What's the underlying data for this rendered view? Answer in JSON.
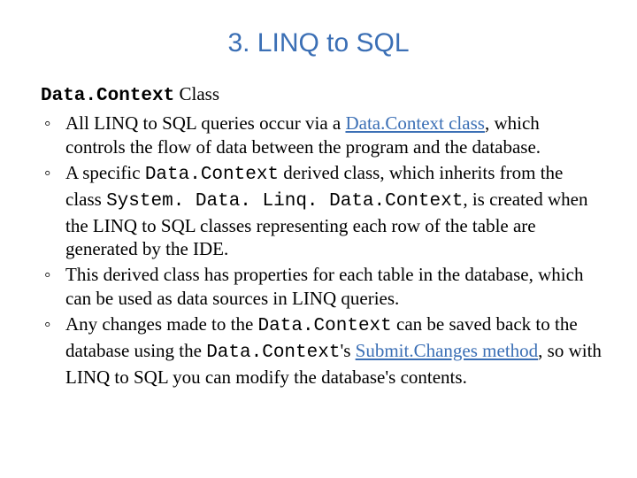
{
  "title": "3. LINQ to SQL",
  "subheading": {
    "code": "Data.Context",
    "rest": " Class"
  },
  "bullets": {
    "b1": {
      "pre": "All LINQ to SQL queries occur via a ",
      "link": "Data.Context class",
      "post": ", which controls the flow of data between the program and the database."
    },
    "b2": {
      "t1": "A specific ",
      "c1": "Data.Context",
      "t2": " derived class, which inherits from the class ",
      "c2": "System. Data. Linq. Data.Context",
      "t3": ", is created when the LINQ to SQL classes representing each row of the table are generated by the IDE."
    },
    "b3": {
      "t1": "This derived class has properties for each table in the database, which can be used as data sources in LINQ queries."
    },
    "b4": {
      "t1": "Any changes made to the ",
      "c1": "Data.Context",
      "t2": " can be saved back to the database using the ",
      "c2": "Data.Context",
      "t3": "'s ",
      "link": "Submit.Changes method",
      "t4": ", so with LINQ to SQL you can modify the database's contents."
    }
  }
}
